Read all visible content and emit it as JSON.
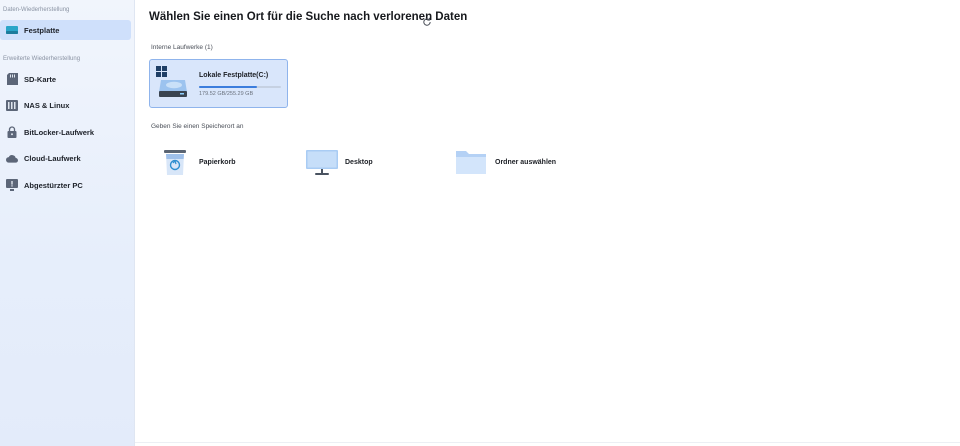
{
  "sidebar": {
    "section_data_recovery": "Daten-Wiederherstellung",
    "section_advanced": "Erweiterte Wiederherstellung",
    "items": [
      {
        "label": "Festplatte",
        "icon": "hard-drive-icon",
        "active": true
      },
      {
        "label": "SD-Karte",
        "icon": "sd-card-icon"
      },
      {
        "label": "NAS & Linux",
        "icon": "nas-icon"
      },
      {
        "label": "BitLocker-Laufwerk",
        "icon": "bitlocker-icon"
      },
      {
        "label": "Cloud-Laufwerk",
        "icon": "cloud-icon"
      },
      {
        "label": "Abgestürzter PC",
        "icon": "crashed-pc-icon"
      }
    ]
  },
  "main": {
    "title": "Wählen Sie einen Ort für die Suche nach verlorenen Daten",
    "internal_drives_label": "Interne Laufwerke (1)",
    "drive": {
      "name": "Lokale Festplatte(C:)",
      "size": "179.52 GB/255.29 GB",
      "used_fraction": 0.703
    },
    "specify_location_label": "Geben Sie einen Speicherort an",
    "locations": [
      {
        "label": "Papierkorb",
        "icon": "recycle-bin-icon"
      },
      {
        "label": "Desktop",
        "icon": "desktop-icon"
      },
      {
        "label": "Ordner auswählen",
        "icon": "folder-icon"
      }
    ]
  },
  "colors": {
    "accent": "#3b7ddd",
    "sidebar_active": "#cfe0fb",
    "card_bg": "#d9e6fb",
    "card_border": "#8fb4ec"
  }
}
